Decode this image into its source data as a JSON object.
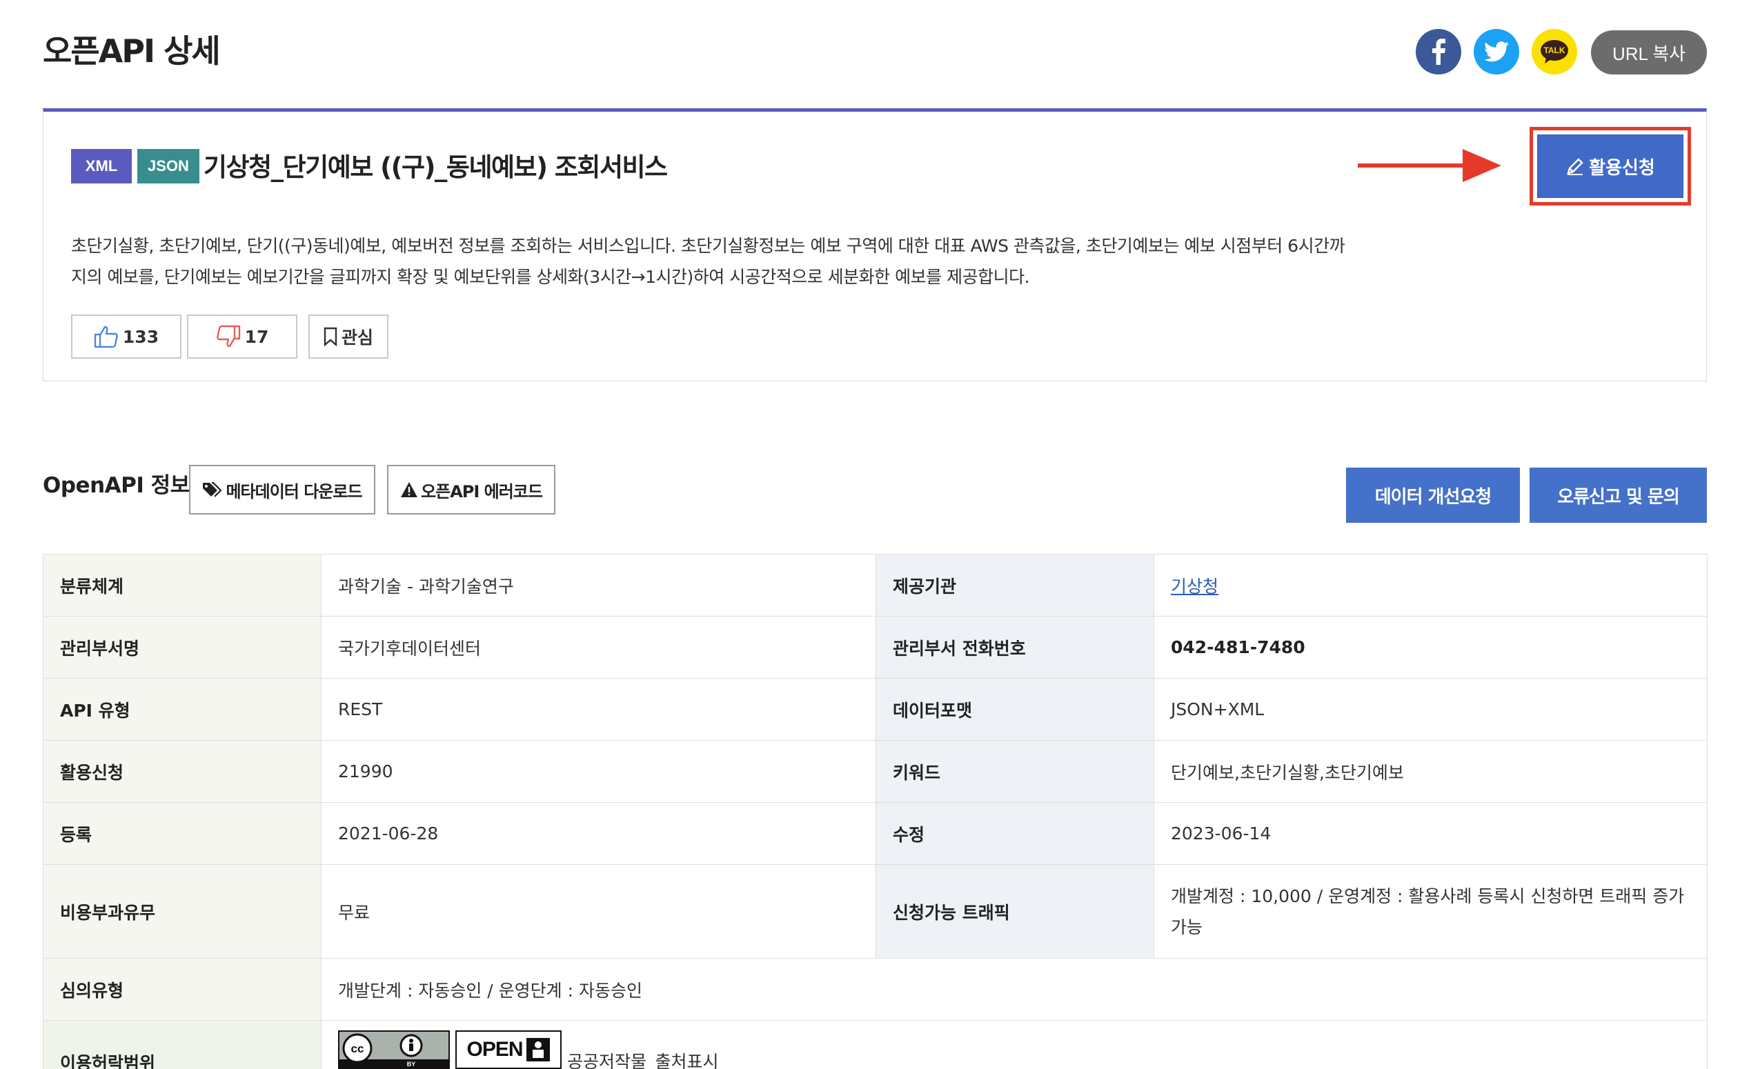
{
  "header": {
    "title": "오픈API 상세",
    "url_copy_label": "URL 복사",
    "share_icons": [
      "facebook-icon",
      "twitter-icon",
      "kakaotalk-icon"
    ],
    "kakao_label": "TALK"
  },
  "summary": {
    "badges": [
      "XML",
      "JSON"
    ],
    "title": "기상청_단기예보 ((구)_동네예보) 조회서비스",
    "apply_label": "활용신청",
    "description": "초단기실황, 초단기예보, 단기((구)동네)예보, 예보버전 정보를 조회하는 서비스입니다. 초단기실황정보는 예보 구역에 대한 대표 AWS 관측값을, 초단기예보는 예보 시점부터 6시간까지의 예보를, 단기예보는 예보기간을 글피까지 확장 및 예보단위를 상세화(3시간→1시간)하여 시공간적으로 세분화한 예보를 제공합니다.",
    "likes": "133",
    "dislikes": "17",
    "favorite_label": "관심"
  },
  "openapi": {
    "section_title": "OpenAPI 정보",
    "meta_download_label": "메타데이터 다운로드",
    "error_code_label": "오픈API 에러코드",
    "improve_request_label": "데이터 개선요청",
    "report_label": "오류신고 및 문의"
  },
  "table": {
    "category_label": "분류체계",
    "category_value": "과학기술 - 과학기술연구",
    "provider_label": "제공기관",
    "provider_value": "기상청",
    "dept_label": "관리부서명",
    "dept_value": "국가기후데이터센터",
    "phone_label": "관리부서 전화번호",
    "phone_value": "042-481-7480",
    "api_type_label": "API 유형",
    "api_type_value": "REST",
    "format_label": "데이터포맷",
    "format_value": "JSON+XML",
    "apply_count_label": "활용신청",
    "apply_count_value": "21990",
    "keyword_label": "키워드",
    "keyword_value": "단기예보,초단기실황,초단기예보",
    "registered_label": "등록",
    "registered_value": "2021-06-28",
    "modified_label": "수정",
    "modified_value": "2023-06-14",
    "cost_label": "비용부과유무",
    "cost_value": "무료",
    "traffic_label": "신청가능 트래픽",
    "traffic_value": "개발계정 : 10,000 / 운영계정 : 활용사례 등록시 신청하면 트래픽 증가 가능",
    "review_label": "심의유형",
    "review_value": "개발단계 : 자동승인 / 운영단계 : 자동승인",
    "license_label": "이용허락범위",
    "license_value": "공공저작물_출처표시",
    "license_open_text": "OPEN"
  }
}
